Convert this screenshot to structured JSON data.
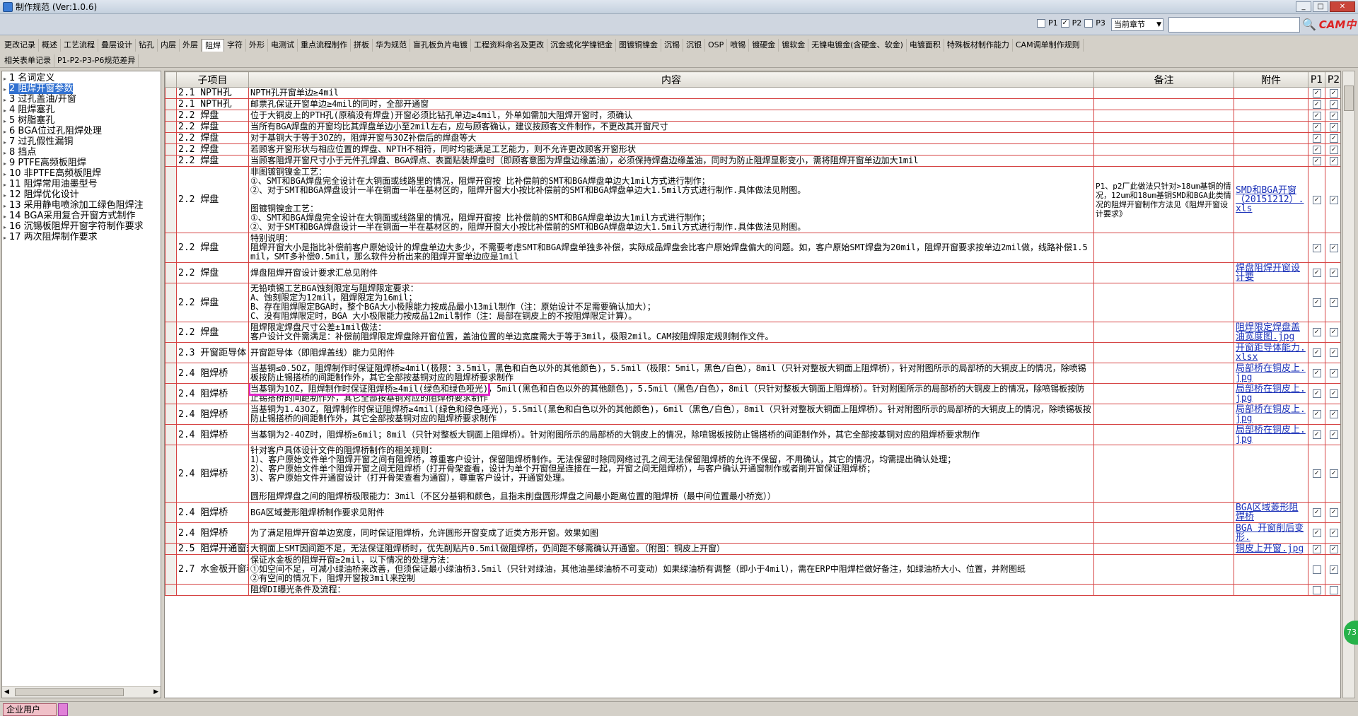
{
  "window": {
    "title": "制作规范 (Ver:1.0.6)"
  },
  "filters": {
    "p1": "P1",
    "p1_checked": false,
    "p2": "P2",
    "p2_checked": true,
    "p3": "P3",
    "p3_checked": false,
    "chapter_select": "当前章节",
    "search_value": ""
  },
  "logo": {
    "text": "CAM中心"
  },
  "tabs_row1": [
    "更改记录",
    "概述",
    "工艺流程",
    "叠层设计",
    "钻孔",
    "内层",
    "外层",
    "阻焊",
    "字符",
    "外形",
    "电测试",
    "重点流程制作",
    "拼板",
    "华为规范",
    "盲孔板负片电镀",
    "工程资料命名及更改",
    "沉金或化学镍钯金",
    "图镀铜镍金",
    "沉锡",
    "沉银",
    "OSP",
    "喷锡",
    "镀硬金",
    "镀软金",
    "无镍电镀金(含硬金、软金)",
    "电镀面积",
    "特殊板材制作能力",
    "CAM调单制作规则"
  ],
  "tabs_row1_active": "阻焊",
  "tabs_row2": [
    "相关表单记录",
    "P1-P2-P3-P6规范差异"
  ],
  "tree": [
    {
      "label": "1  名词定义",
      "selected": false
    },
    {
      "label": "2  阻焊开窗参数",
      "selected": true
    },
    {
      "label": "3  过孔盖油/开窗",
      "selected": false
    },
    {
      "label": "4  阻焊塞孔",
      "selected": false
    },
    {
      "label": "5  树脂塞孔",
      "selected": false
    },
    {
      "label": "6  BGA位过孔阻焊处理",
      "selected": false
    },
    {
      "label": "7  过孔假性漏铜",
      "selected": false
    },
    {
      "label": "8  挡点",
      "selected": false
    },
    {
      "label": "9  PTFE高频板阻焊",
      "selected": false
    },
    {
      "label": "10  非PTFE高频板阻焊",
      "selected": false
    },
    {
      "label": "11  阻焊常用油墨型号",
      "selected": false
    },
    {
      "label": "12  阻焊优化设计",
      "selected": false
    },
    {
      "label": "13  采用静电喷涂加工绿色阻焊注",
      "selected": false
    },
    {
      "label": "14  BGA采用复合开窗方式制作",
      "selected": false
    },
    {
      "label": "16  沉锡板阻焊开窗字符制作要求",
      "selected": false
    },
    {
      "label": "17  两次阻焊制作要求",
      "selected": false
    }
  ],
  "columns": {
    "sub": "子项目",
    "content": "内容",
    "note": "备注",
    "attach": "附件",
    "p1": "P1",
    "p2": "P2",
    "p3": "P3"
  },
  "rows": [
    {
      "sub": "2.1 NPTH孔",
      "content": "NPTH孔开窗单边≥4mil",
      "note": "",
      "attach": "",
      "p": [
        true,
        true,
        true
      ]
    },
    {
      "sub": "2.1 NPTH孔",
      "content": "邮票孔保证开窗单边≥4mil的同时，全部开通窗",
      "note": "",
      "attach": "",
      "p": [
        true,
        true,
        true
      ]
    },
    {
      "sub": "2.2 焊盘",
      "content": "位于大铜皮上的PTH孔(原稿没有焊盘)开窗必须比钻孔单边≥4mil，外单如需加大阻焊开窗时，须确认",
      "note": "",
      "attach": "",
      "p": [
        true,
        true,
        true
      ]
    },
    {
      "sub": "2.2 焊盘",
      "content": "当所有BGA焊盘的开窗均比其焊盘单边小至2mil左右，应与顾客确认，建议按顾客文件制作，不更改其开窗尺寸",
      "note": "",
      "attach": "",
      "p": [
        true,
        true,
        false
      ]
    },
    {
      "sub": "2.2 焊盘",
      "content": "对于基铜大于等于3OZ的，阻焊开窗与3OZ补偿后的焊盘等大",
      "note": "",
      "attach": "",
      "p": [
        true,
        true,
        true
      ]
    },
    {
      "sub": "2.2 焊盘",
      "content": "若顾客开窗形状与相应位置的焊盘、NPTH不相符，同时均能满足工艺能力，则不允许更改顾客开窗形状",
      "note": "",
      "attach": "",
      "p": [
        true,
        true,
        false
      ]
    },
    {
      "sub": "2.2 焊盘",
      "content": "当顾客阻焊开窗尺寸小于元件孔焊盘、BGA焊点、表面贴装焊盘时（即顾客意图为焊盘边缘盖油），必须保持焊盘边缘盖油，同时为防止阻焊显影变小，需将阻焊开窗单边加大1mil",
      "note": "",
      "attach": "",
      "p": [
        true,
        true,
        true
      ]
    },
    {
      "sub": "2.2 焊盘",
      "content": "非图镀铜镍金工艺：\n①、SMT和BGA焊盘完全设计在大铜面或线路里的情况，阻焊开窗按 比补偿前的SMT和BGA焊盘单边大1mil方式进行制作；\n②、对于SMT和BGA焊盘设计一半在铜面一半在基材区的，阻焊开窗大小按比补偿前的SMT和BGA焊盘单边大1.5mil方式进行制作.具体做法见附图。\n\n图镀铜镍金工艺：\n①、SMT和BGA焊盘完全设计在大铜面或线路里的情况，阻焊开窗按 比补偿前的SMT和BGA焊盘单边大1mil方式进行制作；\n②、对于SMT和BGA焊盘设计一半在铜面一半在基材区的，阻焊开窗大小按比补偿前的SMT和BGA焊盘单边大1.5mil方式进行制作.具体做法见附图。",
      "note": "P1、p2厂此做法只针对>18um基铜的情况，12um和18um基铜SMD和BGA此类情况的阻焊开窗制作方法见《阻焊开窗设计要求》",
      "attach": "SMD和BGA开窗（20151212）.xls",
      "p": [
        true,
        true,
        true
      ]
    },
    {
      "sub": "2.2 焊盘",
      "content": "特别说明：\n阻焊开窗大小是指比补偿前客户原始设计的焊盘单边大多少，不需要考虑SMT和BGA焊盘单独多补偿，实际成品焊盘会比客户原始焊盘偏大的问题。如，客户原始SMT焊盘为20mil，阻焊开窗要求按单边2mil做，线路补偿1.5mil，SMT多补偿0.5mil，那么软件分析出来的阻焊开窗单边应是1mil",
      "note": "",
      "attach": "",
      "p": [
        true,
        true,
        true
      ]
    },
    {
      "sub": "2.2 焊盘",
      "content": "焊盘阻焊开窗设计要求汇总见附件",
      "note": "",
      "attach": "焊盘阻焊开窗设计要",
      "p": [
        true,
        true,
        false
      ]
    },
    {
      "sub": "2.2 焊盘",
      "content": "无铅喷锡工艺BGA蚀刻限定与阻焊限定要求：\nA、蚀刻限定为12mil，阻焊限定为16mil；\nB、存在阻焊限定BGA时，整个BGA大小极限能力按成品最小13mil制作（注：原始设计不足需要确认加大）；\nC、没有阻焊限定时，BGA 大小极限能力按成品12mil制作（注：局部在铜皮上的不按阻焊限定计算）。",
      "note": "",
      "attach": "",
      "p": [
        true,
        true,
        false
      ]
    },
    {
      "sub": "2.2 焊盘",
      "content": "阻焊限定焊盘尺寸公差±1mil做法：\n客户设计文件需满足：补偿前阻焊限定焊盘除开窗位置，盖油位置的单边宽度需大于等于3mil，极限2mil。CAM按阻焊限定规则制作文件。",
      "note": "",
      "attach": "阻焊限定焊盘盖油宽度图.jpg",
      "p": [
        true,
        true,
        true
      ]
    },
    {
      "sub": "2.3 开窗距导体",
      "content": "开窗距导体（即阻焊盖线）能力见附件",
      "note": "",
      "attach": "开窗距导体能力.xlsx",
      "p": [
        true,
        true,
        true
      ]
    },
    {
      "sub": "2.4 阻焊桥",
      "content": "当基铜≤0.5OZ，阻焊制作时保证阻焊桥≥4mil(极限：3.5mil，黑色和白色以外的其他颜色)，5.5mil（极限：5mil，黑色/白色），8mil（只针对整板大铜面上阻焊桥），针对附图所示的局部桥的大铜皮上的情况，除喷锡板按防止锡搭桥的间距制作外，其它全部按基铜对应的阻焊桥要求制作",
      "note": "",
      "attach": "局部桥在铜皮上.jpg",
      "p": [
        true,
        true,
        true
      ]
    },
    {
      "sub": "2.4 阻焊桥",
      "content": "当基铜为1OZ，阻焊制作时保证阻焊桥≥4mil(绿色和绿色哑光)，5mil(黑色和白色以外的其他颜色)，5.5mil（黑色/白色），8mil（只针对整板大铜面上阻焊桥）。针对附图所示的局部桥的大铜皮上的情况，除喷锡板按防止锡搭桥的间距制作外，其它全部按基铜对应的阻焊桥要求制作",
      "note": "",
      "attach": "局部桥在铜皮上.jpg",
      "p": [
        true,
        true,
        true
      ],
      "highlight": "当基铜为1OZ，阻焊制作时保证阻焊桥≥4mil(绿色和绿色哑光)"
    },
    {
      "sub": "2.4 阻焊桥",
      "content": "当基铜为1.43OZ，阻焊制作时保证阻焊桥≥4mil(绿色和绿色哑光)，5.5mil(黑色和白色以外的其他颜色)，6mil（黑色/白色），8mil（只针对整板大铜面上阻焊桥）。针对附图所示的局部桥的大铜皮上的情况，除喷锡板按防止锡搭桥的间距制作外，其它全部按基铜对应的阻焊桥要求制作",
      "note": "",
      "attach": "局部桥在铜皮上.jpg",
      "p": [
        true,
        true,
        true
      ]
    },
    {
      "sub": "2.4 阻焊桥",
      "content": "当基铜为2-4OZ时，阻焊桥≥6mil；8mil（只针对整板大铜面上阻焊桥）。针对附图所示的局部桥的大铜皮上的情况，除喷锡板按防止锡搭桥的间距制作外，其它全部按基铜对应的阻焊桥要求制作",
      "note": "",
      "attach": "局部桥在铜皮上.jpg",
      "p": [
        true,
        true,
        true
      ]
    },
    {
      "sub": "2.4 阻焊桥",
      "content": "针对客户具体设计文件的阻焊桥制作的相关规则：\n1）、客户原始文件单个阻焊开窗之间有阻焊桥，尊重客户设计，保留阻焊桥制作。无法保留时除同网络过孔之间无法保留阻焊桥的允许不保留，不用确认，其它的情况，均需提出确认处理；\n2）、客户原始文件单个阻焊开窗之间无阻焊桥（打开骨架查看，设计为单个开窗但是连接在一起，开窗之间无阻焊桥），与客户确认开通窗制作或者削开窗保证阻焊桥；\n3）、客户原始文件开通窗设计（打开骨架查看为通窗），尊重客户设计，开通窗处理。\n\n圆形阻焊焊盘之间的阻焊桥极限能力：3mil（不区分基铜和颜色，且指未削盘圆形焊盘之间最小距离位置的阻焊桥（最中间位置最小桥宽））",
      "note": "",
      "attach": "",
      "p": [
        true,
        true,
        true
      ]
    },
    {
      "sub": "2.4 阻焊桥",
      "content": "BGA区域菱形阻焊桥制作要求见附件",
      "note": "",
      "attach": "BGA区域菱形阻焊桥",
      "p": [
        true,
        true,
        true
      ]
    },
    {
      "sub": "2.4 阻焊桥",
      "content": "为了满足阻焊开窗单边宽度，同时保证阻焊桥，允许圆形开窗变成了近类方形开窗。效果如图",
      "note": "",
      "attach": "BGA 开窗削后变形.",
      "p": [
        true,
        true,
        true
      ]
    },
    {
      "sub": "2.5 阻焊开通窗规则",
      "content": "大铜面上SMT因间距不足，无法保证阻焊桥时，优先削贴片0.5mil做阻焊桥，仍间距不够需确认开通窗。（附图：铜皮上开窗）",
      "note": "",
      "attach": "铜皮上开窗.jpg",
      "p": [
        true,
        true,
        true
      ]
    },
    {
      "sub": "2.7 水金板开窗和阻焊桥",
      "content": "保证水金板的阻焊开窗≥2mil，以下情况的处理方法：\n①如空间不足，可减小绿油桥来改善，但须保证最小绿油桥3.5mil（只针对绿油，其他油墨绿油桥不可变动）如果绿油桥有调整（即小于4mil），需在ERP中阻焊栏做好备注，如绿油桥大小、位置，并附图纸\n②有空间的情况下，阻焊开窗按3mil来控制",
      "note": "",
      "attach": "",
      "p": [
        false,
        true,
        false
      ]
    },
    {
      "sub": "",
      "content": "阻焊DI曝光条件及流程：",
      "note": "",
      "attach": "",
      "p": [
        false,
        false,
        false
      ]
    }
  ],
  "status": {
    "badge": "73",
    "bottom_button": "企业用户"
  }
}
